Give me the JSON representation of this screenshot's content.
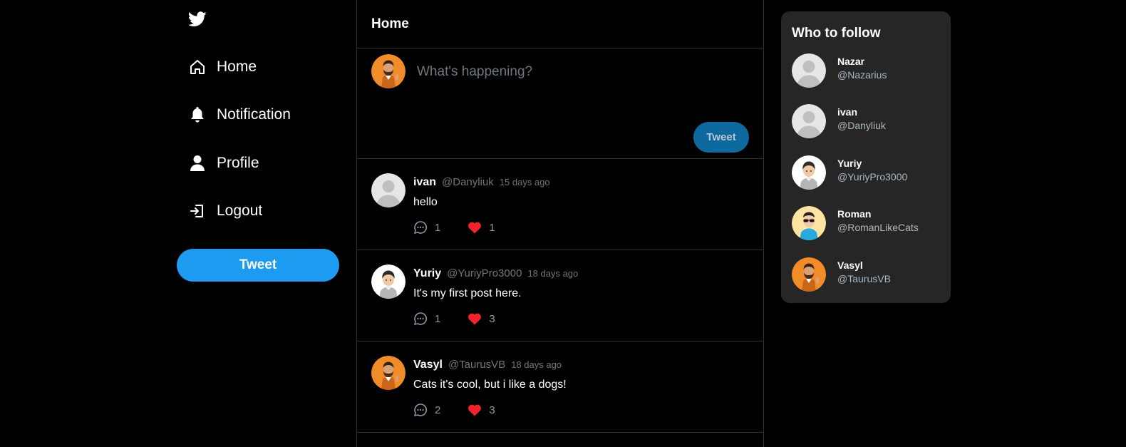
{
  "sidebar": {
    "logo": "twitter-bird-icon",
    "items": [
      {
        "label": "Home",
        "icon": "home-icon"
      },
      {
        "label": "Notification",
        "icon": "bell-icon"
      },
      {
        "label": "Profile",
        "icon": "user-icon"
      },
      {
        "label": "Logout",
        "icon": "logout-icon"
      }
    ],
    "tweet_button": "Tweet"
  },
  "feed": {
    "title": "Home",
    "composer": {
      "placeholder": "What's happening?",
      "tweet_button": "Tweet",
      "avatar": "bearded-man-orange-avatar"
    },
    "posts": [
      {
        "name": "ivan",
        "handle": "@Danyliuk",
        "time": "15 days ago",
        "text": "hello",
        "comments": "1",
        "likes": "1",
        "avatar": "default-avatar"
      },
      {
        "name": "Yuriy",
        "handle": "@YuriyPro3000",
        "time": "18 days ago",
        "text": "It's my first post here.",
        "comments": "1",
        "likes": "3",
        "avatar": "boy-grey-shirt-avatar"
      },
      {
        "name": "Vasyl",
        "handle": "@TaurusVB",
        "time": "18 days ago",
        "text": "Cats it's cool, but i like a dogs!",
        "comments": "2",
        "likes": "3",
        "avatar": "bearded-man-orange-avatar"
      }
    ]
  },
  "who_to_follow": {
    "title": "Who to follow",
    "users": [
      {
        "name": "Nazar",
        "handle": "@Nazarius",
        "avatar": "default-avatar"
      },
      {
        "name": "ivan",
        "handle": "@Danyliuk",
        "avatar": "default-avatar"
      },
      {
        "name": "Yuriy",
        "handle": "@YuriyPro3000",
        "avatar": "boy-grey-shirt-avatar"
      },
      {
        "name": "Roman",
        "handle": "@RomanLikeCats",
        "avatar": "man-sunglasses-avatar"
      },
      {
        "name": "Vasyl",
        "handle": "@TaurusVB",
        "avatar": "bearded-man-orange-avatar"
      }
    ]
  },
  "colors": {
    "background": "#000000",
    "accent": "#1d9bf0",
    "composer_button": "#0e6a9e",
    "like": "#f4212e",
    "panel": "#262626",
    "divider": "#2f3336"
  }
}
